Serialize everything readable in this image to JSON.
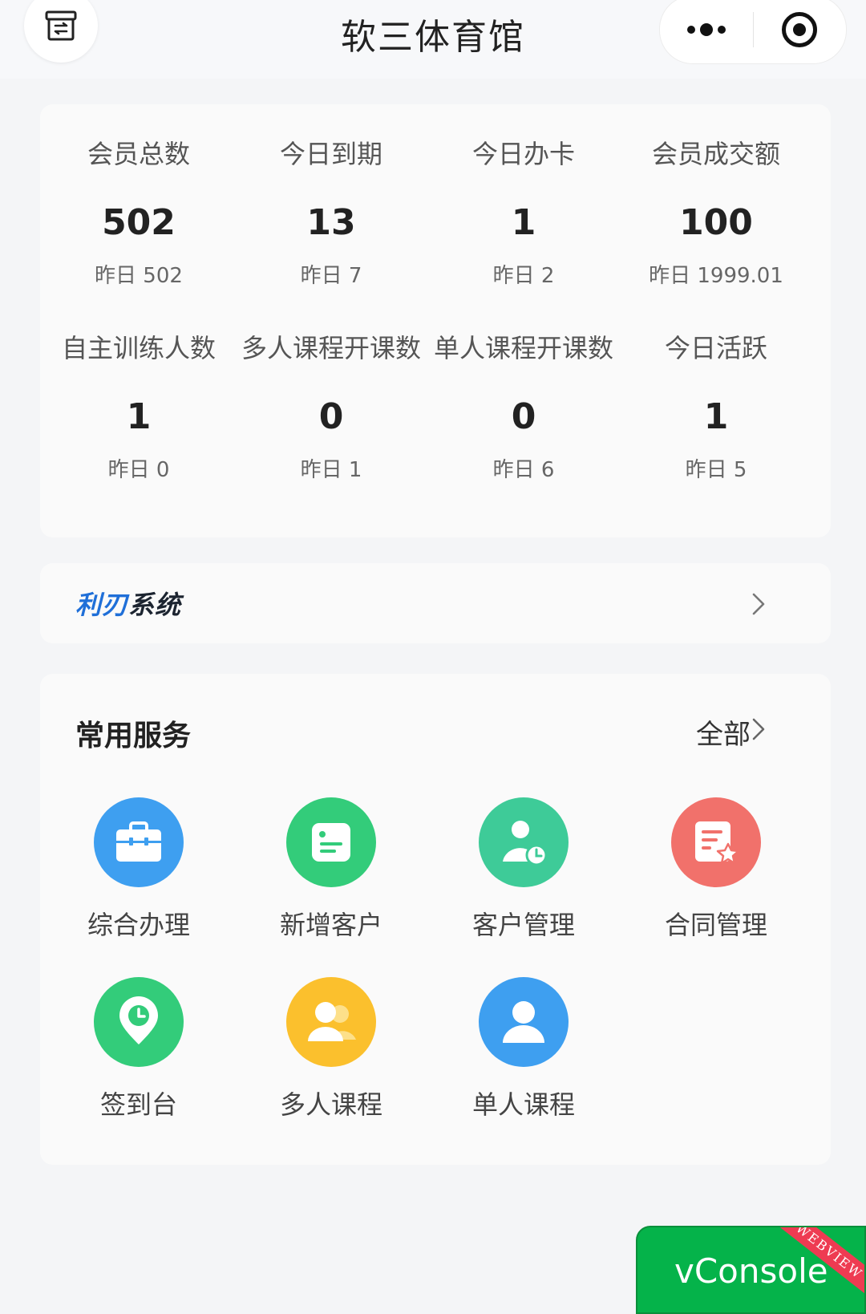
{
  "header": {
    "title": "软三体育馆",
    "icons": {
      "left": "archive-box-icon",
      "more": "more-dots-icon",
      "close": "target-circle-icon"
    }
  },
  "stats": [
    {
      "label": "会员总数",
      "value": "502",
      "yesterday": "昨日 502"
    },
    {
      "label": "今日到期",
      "value": "13",
      "yesterday": "昨日 7"
    },
    {
      "label": "今日办卡",
      "value": "1",
      "yesterday": "昨日 2"
    },
    {
      "label": "会员成交额",
      "value": "100",
      "yesterday": "昨日 1999.01"
    },
    {
      "label": "自主训练人数",
      "value": "1",
      "yesterday": "昨日 0"
    },
    {
      "label": "多人课程开课数",
      "value": "0",
      "yesterday": "昨日 1"
    },
    {
      "label": "单人课程开课数",
      "value": "0",
      "yesterday": "昨日 6"
    },
    {
      "label": "今日活跃",
      "value": "1",
      "yesterday": "昨日 5"
    }
  ],
  "banner": {
    "brand_part1": "利刃",
    "brand_part2": "系统"
  },
  "services": {
    "title": "常用服务",
    "all_label": "全部",
    "items": [
      {
        "label": "综合办理",
        "icon": "briefcase-icon",
        "color": "#3e9ff0"
      },
      {
        "label": "新增客户",
        "icon": "document-list-icon",
        "color": "#33cc7a"
      },
      {
        "label": "客户管理",
        "icon": "user-clock-icon",
        "color": "#3ecb98"
      },
      {
        "label": "合同管理",
        "icon": "contract-star-icon",
        "color": "#f1716b"
      },
      {
        "label": "签到台",
        "icon": "location-clock-icon",
        "color": "#33cc7a"
      },
      {
        "label": "多人课程",
        "icon": "group-users-icon",
        "color": "#fbc02d"
      },
      {
        "label": "单人课程",
        "icon": "single-user-icon",
        "color": "#3e9ff0"
      }
    ]
  },
  "vconsole": {
    "label": "vConsole",
    "ribbon": "WEBVIEW"
  }
}
